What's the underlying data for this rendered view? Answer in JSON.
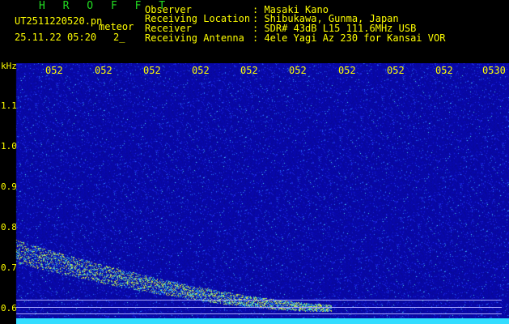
{
  "header": {
    "app_name": "H R O F F T",
    "file_name": "UT2511220520.pn",
    "type_label": "meteor",
    "date_time": "25.11.22 05:20",
    "index": "2_",
    "observer_label": "Observer",
    "observer_value": ": Masaki Kano",
    "location_label": "Receiving Location",
    "location_value": ": Shibukawa, Gunma, Japan",
    "receiver_label": "Receiver",
    "receiver_value": ": SDR# 43dB L15 111.6MHz USB",
    "antenna_label": "Receiving Antenna",
    "antenna_value": ": 4ele Yagi Az 230 for Kansai VOR"
  },
  "axes": {
    "y_unit": "kHz",
    "time_ticks": [
      "052",
      "052",
      "052",
      "052",
      "052",
      "052",
      "052",
      "052",
      "052",
      "0530"
    ],
    "freq_ticks": [
      "1.1",
      "1.0",
      "0.9",
      "0.8",
      "0.7",
      "0.6"
    ]
  },
  "colors": {
    "background": "#0a0a9c",
    "text": "#ffff00",
    "title": "#22dd22",
    "baseline": "#33ddff"
  }
}
